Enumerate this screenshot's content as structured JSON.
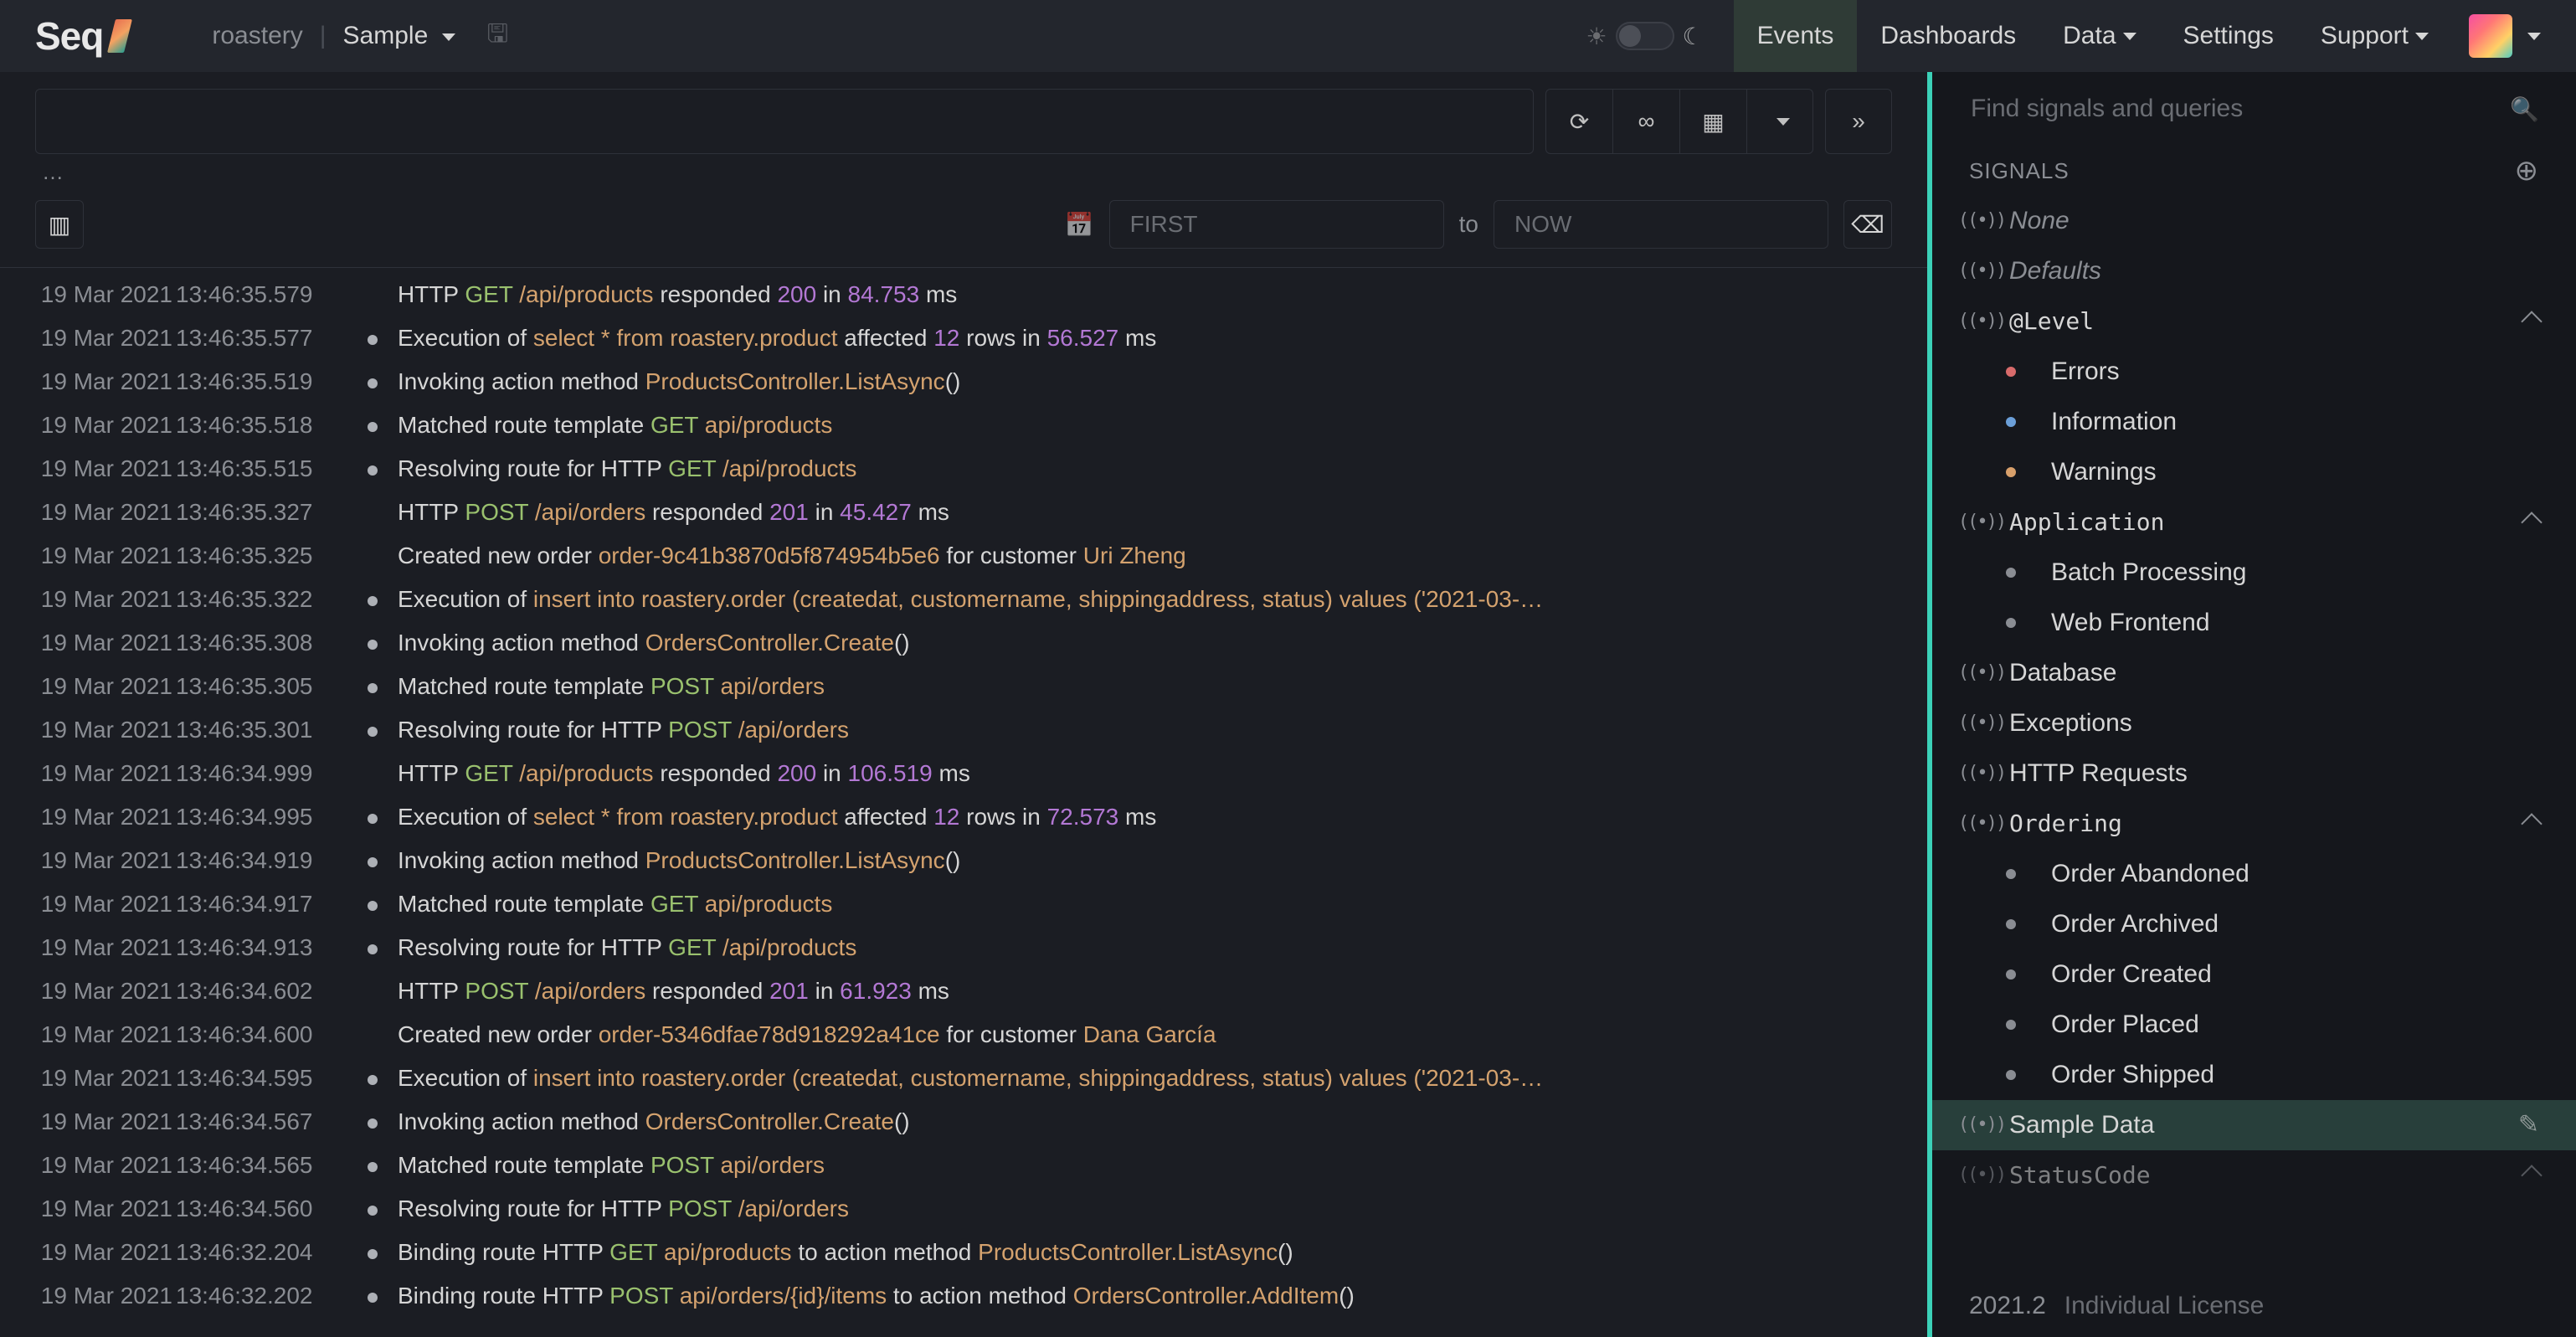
{
  "header": {
    "logo": "Seq",
    "workspace": "roastery",
    "project": "Sample",
    "nav": [
      {
        "label": "Events",
        "active": true
      },
      {
        "label": "Dashboards"
      },
      {
        "label": "Data",
        "dropdown": true
      },
      {
        "label": "Settings"
      },
      {
        "label": "Support",
        "dropdown": true
      }
    ]
  },
  "filter": {
    "context_hint": "…"
  },
  "range": {
    "from_placeholder": "FIRST",
    "to_label": "to",
    "to_placeholder": "NOW"
  },
  "events": [
    {
      "date": "19 Mar 2021",
      "time": "13:46:35.579",
      "ind": false,
      "parts": [
        [
          "",
          "HTTP "
        ],
        [
          "green",
          "GET"
        ],
        [
          "",
          " "
        ],
        [
          "orange",
          "/api/products"
        ],
        [
          "",
          " responded "
        ],
        [
          "purple",
          "200"
        ],
        [
          "",
          " in "
        ],
        [
          "purple",
          "84.753"
        ],
        [
          "",
          " ms"
        ]
      ]
    },
    {
      "date": "19 Mar 2021",
      "time": "13:46:35.577",
      "ind": true,
      "parts": [
        [
          "",
          "Execution of "
        ],
        [
          "orange",
          "select * from roastery.product"
        ],
        [
          "",
          " affected "
        ],
        [
          "purple",
          "12"
        ],
        [
          "",
          " rows in "
        ],
        [
          "purple",
          "56.527"
        ],
        [
          "",
          " ms"
        ]
      ]
    },
    {
      "date": "19 Mar 2021",
      "time": "13:46:35.519",
      "ind": true,
      "parts": [
        [
          "",
          "Invoking action method "
        ],
        [
          "orange",
          "ProductsController.ListAsync"
        ],
        [
          "",
          "()"
        ]
      ]
    },
    {
      "date": "19 Mar 2021",
      "time": "13:46:35.518",
      "ind": true,
      "parts": [
        [
          "",
          "Matched route template "
        ],
        [
          "green",
          "GET"
        ],
        [
          "",
          " "
        ],
        [
          "orange",
          "api/products"
        ]
      ]
    },
    {
      "date": "19 Mar 2021",
      "time": "13:46:35.515",
      "ind": true,
      "parts": [
        [
          "",
          "Resolving route for HTTP "
        ],
        [
          "green",
          "GET"
        ],
        [
          "",
          " "
        ],
        [
          "orange",
          "/api/products"
        ]
      ]
    },
    {
      "date": "19 Mar 2021",
      "time": "13:46:35.327",
      "ind": false,
      "parts": [
        [
          "",
          "HTTP "
        ],
        [
          "green",
          "POST"
        ],
        [
          "",
          " "
        ],
        [
          "orange",
          "/api/orders"
        ],
        [
          "",
          " responded "
        ],
        [
          "purple",
          "201"
        ],
        [
          "",
          " in "
        ],
        [
          "purple",
          "45.427"
        ],
        [
          "",
          " ms"
        ]
      ]
    },
    {
      "date": "19 Mar 2021",
      "time": "13:46:35.325",
      "ind": false,
      "parts": [
        [
          "",
          "Created new order "
        ],
        [
          "orange",
          "order-9c41b3870d5f874954b5e6"
        ],
        [
          "",
          " for customer "
        ],
        [
          "orange",
          "Uri Zheng"
        ]
      ]
    },
    {
      "date": "19 Mar 2021",
      "time": "13:46:35.322",
      "ind": true,
      "parts": [
        [
          "",
          "Execution of "
        ],
        [
          "orange",
          "insert into roastery.order (createdat, customername, shippingaddress, status) values ('2021-03-…"
        ]
      ]
    },
    {
      "date": "19 Mar 2021",
      "time": "13:46:35.308",
      "ind": true,
      "parts": [
        [
          "",
          "Invoking action method "
        ],
        [
          "orange",
          "OrdersController.Create"
        ],
        [
          "",
          "()"
        ]
      ]
    },
    {
      "date": "19 Mar 2021",
      "time": "13:46:35.305",
      "ind": true,
      "parts": [
        [
          "",
          "Matched route template "
        ],
        [
          "green",
          "POST"
        ],
        [
          "",
          " "
        ],
        [
          "orange",
          "api/orders"
        ]
      ]
    },
    {
      "date": "19 Mar 2021",
      "time": "13:46:35.301",
      "ind": true,
      "parts": [
        [
          "",
          "Resolving route for HTTP "
        ],
        [
          "green",
          "POST"
        ],
        [
          "",
          " "
        ],
        [
          "orange",
          "/api/orders"
        ]
      ]
    },
    {
      "date": "19 Mar 2021",
      "time": "13:46:34.999",
      "ind": false,
      "parts": [
        [
          "",
          "HTTP "
        ],
        [
          "green",
          "GET"
        ],
        [
          "",
          " "
        ],
        [
          "orange",
          "/api/products"
        ],
        [
          "",
          " responded "
        ],
        [
          "purple",
          "200"
        ],
        [
          "",
          " in "
        ],
        [
          "purple",
          "106.519"
        ],
        [
          "",
          " ms"
        ]
      ]
    },
    {
      "date": "19 Mar 2021",
      "time": "13:46:34.995",
      "ind": true,
      "parts": [
        [
          "",
          "Execution of "
        ],
        [
          "orange",
          "select * from roastery.product"
        ],
        [
          "",
          " affected "
        ],
        [
          "purple",
          "12"
        ],
        [
          "",
          " rows in "
        ],
        [
          "purple",
          "72.573"
        ],
        [
          "",
          " ms"
        ]
      ]
    },
    {
      "date": "19 Mar 2021",
      "time": "13:46:34.919",
      "ind": true,
      "parts": [
        [
          "",
          "Invoking action method "
        ],
        [
          "orange",
          "ProductsController.ListAsync"
        ],
        [
          "",
          "()"
        ]
      ]
    },
    {
      "date": "19 Mar 2021",
      "time": "13:46:34.917",
      "ind": true,
      "parts": [
        [
          "",
          "Matched route template "
        ],
        [
          "green",
          "GET"
        ],
        [
          "",
          " "
        ],
        [
          "orange",
          "api/products"
        ]
      ]
    },
    {
      "date": "19 Mar 2021",
      "time": "13:46:34.913",
      "ind": true,
      "parts": [
        [
          "",
          "Resolving route for HTTP "
        ],
        [
          "green",
          "GET"
        ],
        [
          "",
          " "
        ],
        [
          "orange",
          "/api/products"
        ]
      ]
    },
    {
      "date": "19 Mar 2021",
      "time": "13:46:34.602",
      "ind": false,
      "parts": [
        [
          "",
          "HTTP "
        ],
        [
          "green",
          "POST"
        ],
        [
          "",
          " "
        ],
        [
          "orange",
          "/api/orders"
        ],
        [
          "",
          " responded "
        ],
        [
          "purple",
          "201"
        ],
        [
          "",
          " in "
        ],
        [
          "purple",
          "61.923"
        ],
        [
          "",
          " ms"
        ]
      ]
    },
    {
      "date": "19 Mar 2021",
      "time": "13:46:34.600",
      "ind": false,
      "parts": [
        [
          "",
          "Created new order "
        ],
        [
          "orange",
          "order-5346dfae78d918292a41ce"
        ],
        [
          "",
          " for customer "
        ],
        [
          "orange",
          "Dana García"
        ]
      ]
    },
    {
      "date": "19 Mar 2021",
      "time": "13:46:34.595",
      "ind": true,
      "parts": [
        [
          "",
          "Execution of "
        ],
        [
          "orange",
          "insert into roastery.order (createdat, customername, shippingaddress, status) values ('2021-03-…"
        ]
      ]
    },
    {
      "date": "19 Mar 2021",
      "time": "13:46:34.567",
      "ind": true,
      "parts": [
        [
          "",
          "Invoking action method "
        ],
        [
          "orange",
          "OrdersController.Create"
        ],
        [
          "",
          "()"
        ]
      ]
    },
    {
      "date": "19 Mar 2021",
      "time": "13:46:34.565",
      "ind": true,
      "parts": [
        [
          "",
          "Matched route template "
        ],
        [
          "green",
          "POST"
        ],
        [
          "",
          " "
        ],
        [
          "orange",
          "api/orders"
        ]
      ]
    },
    {
      "date": "19 Mar 2021",
      "time": "13:46:34.560",
      "ind": true,
      "parts": [
        [
          "",
          "Resolving route for HTTP "
        ],
        [
          "green",
          "POST"
        ],
        [
          "",
          " "
        ],
        [
          "orange",
          "/api/orders"
        ]
      ]
    },
    {
      "date": "19 Mar 2021",
      "time": "13:46:32.204",
      "ind": true,
      "parts": [
        [
          "",
          "Binding route HTTP "
        ],
        [
          "green",
          "GET"
        ],
        [
          "",
          " "
        ],
        [
          "orange",
          "api/products"
        ],
        [
          "",
          " to action method "
        ],
        [
          "orange",
          "ProductsController.ListAsync"
        ],
        [
          "",
          "()"
        ]
      ]
    },
    {
      "date": "19 Mar 2021",
      "time": "13:46:32.202",
      "ind": true,
      "parts": [
        [
          "",
          "Binding route HTTP "
        ],
        [
          "green",
          "POST"
        ],
        [
          "",
          " "
        ],
        [
          "orange",
          "api/orders/{id}/items"
        ],
        [
          "",
          " to action method "
        ],
        [
          "orange",
          "OrdersController.AddItem"
        ],
        [
          "",
          "()"
        ]
      ]
    }
  ],
  "sidebar": {
    "search_placeholder": "Find signals and queries",
    "section": "SIGNALS",
    "items": [
      {
        "kind": "plain",
        "label": "None",
        "icon": "broadcast",
        "italic": true
      },
      {
        "kind": "plain",
        "label": "Defaults",
        "icon": "broadcast",
        "italic": true
      },
      {
        "kind": "group",
        "label": "@Level",
        "icon": "broadcast",
        "chev": true,
        "children": [
          {
            "kind": "child",
            "label": "Errors",
            "bullet": "red"
          },
          {
            "kind": "child",
            "label": "Information",
            "bullet": "blue"
          },
          {
            "kind": "child",
            "label": "Warnings",
            "bullet": "orange"
          }
        ]
      },
      {
        "kind": "group",
        "label": "Application",
        "icon": "broadcast",
        "chev": true,
        "children": [
          {
            "kind": "child",
            "label": "Batch Processing"
          },
          {
            "kind": "child",
            "label": "Web Frontend"
          }
        ]
      },
      {
        "kind": "plain",
        "label": "Database",
        "icon": "broadcast"
      },
      {
        "kind": "plain",
        "label": "Exceptions",
        "icon": "broadcast"
      },
      {
        "kind": "plain",
        "label": "HTTP Requests",
        "icon": "broadcast"
      },
      {
        "kind": "group",
        "label": "Ordering",
        "icon": "broadcast",
        "chev": true,
        "children": [
          {
            "kind": "child",
            "label": "Order Abandoned"
          },
          {
            "kind": "child",
            "label": "Order Archived"
          },
          {
            "kind": "child",
            "label": "Order Created"
          },
          {
            "kind": "child",
            "label": "Order Placed"
          },
          {
            "kind": "child",
            "label": "Order Shipped"
          }
        ]
      },
      {
        "kind": "plain",
        "label": "Sample Data",
        "icon": "broadcast",
        "active": true,
        "editable": true
      },
      {
        "kind": "group",
        "label": "StatusCode",
        "icon": "broadcast",
        "chev": true,
        "dim": true
      }
    ],
    "footer": {
      "version": "2021.2",
      "license": "Individual License"
    }
  }
}
